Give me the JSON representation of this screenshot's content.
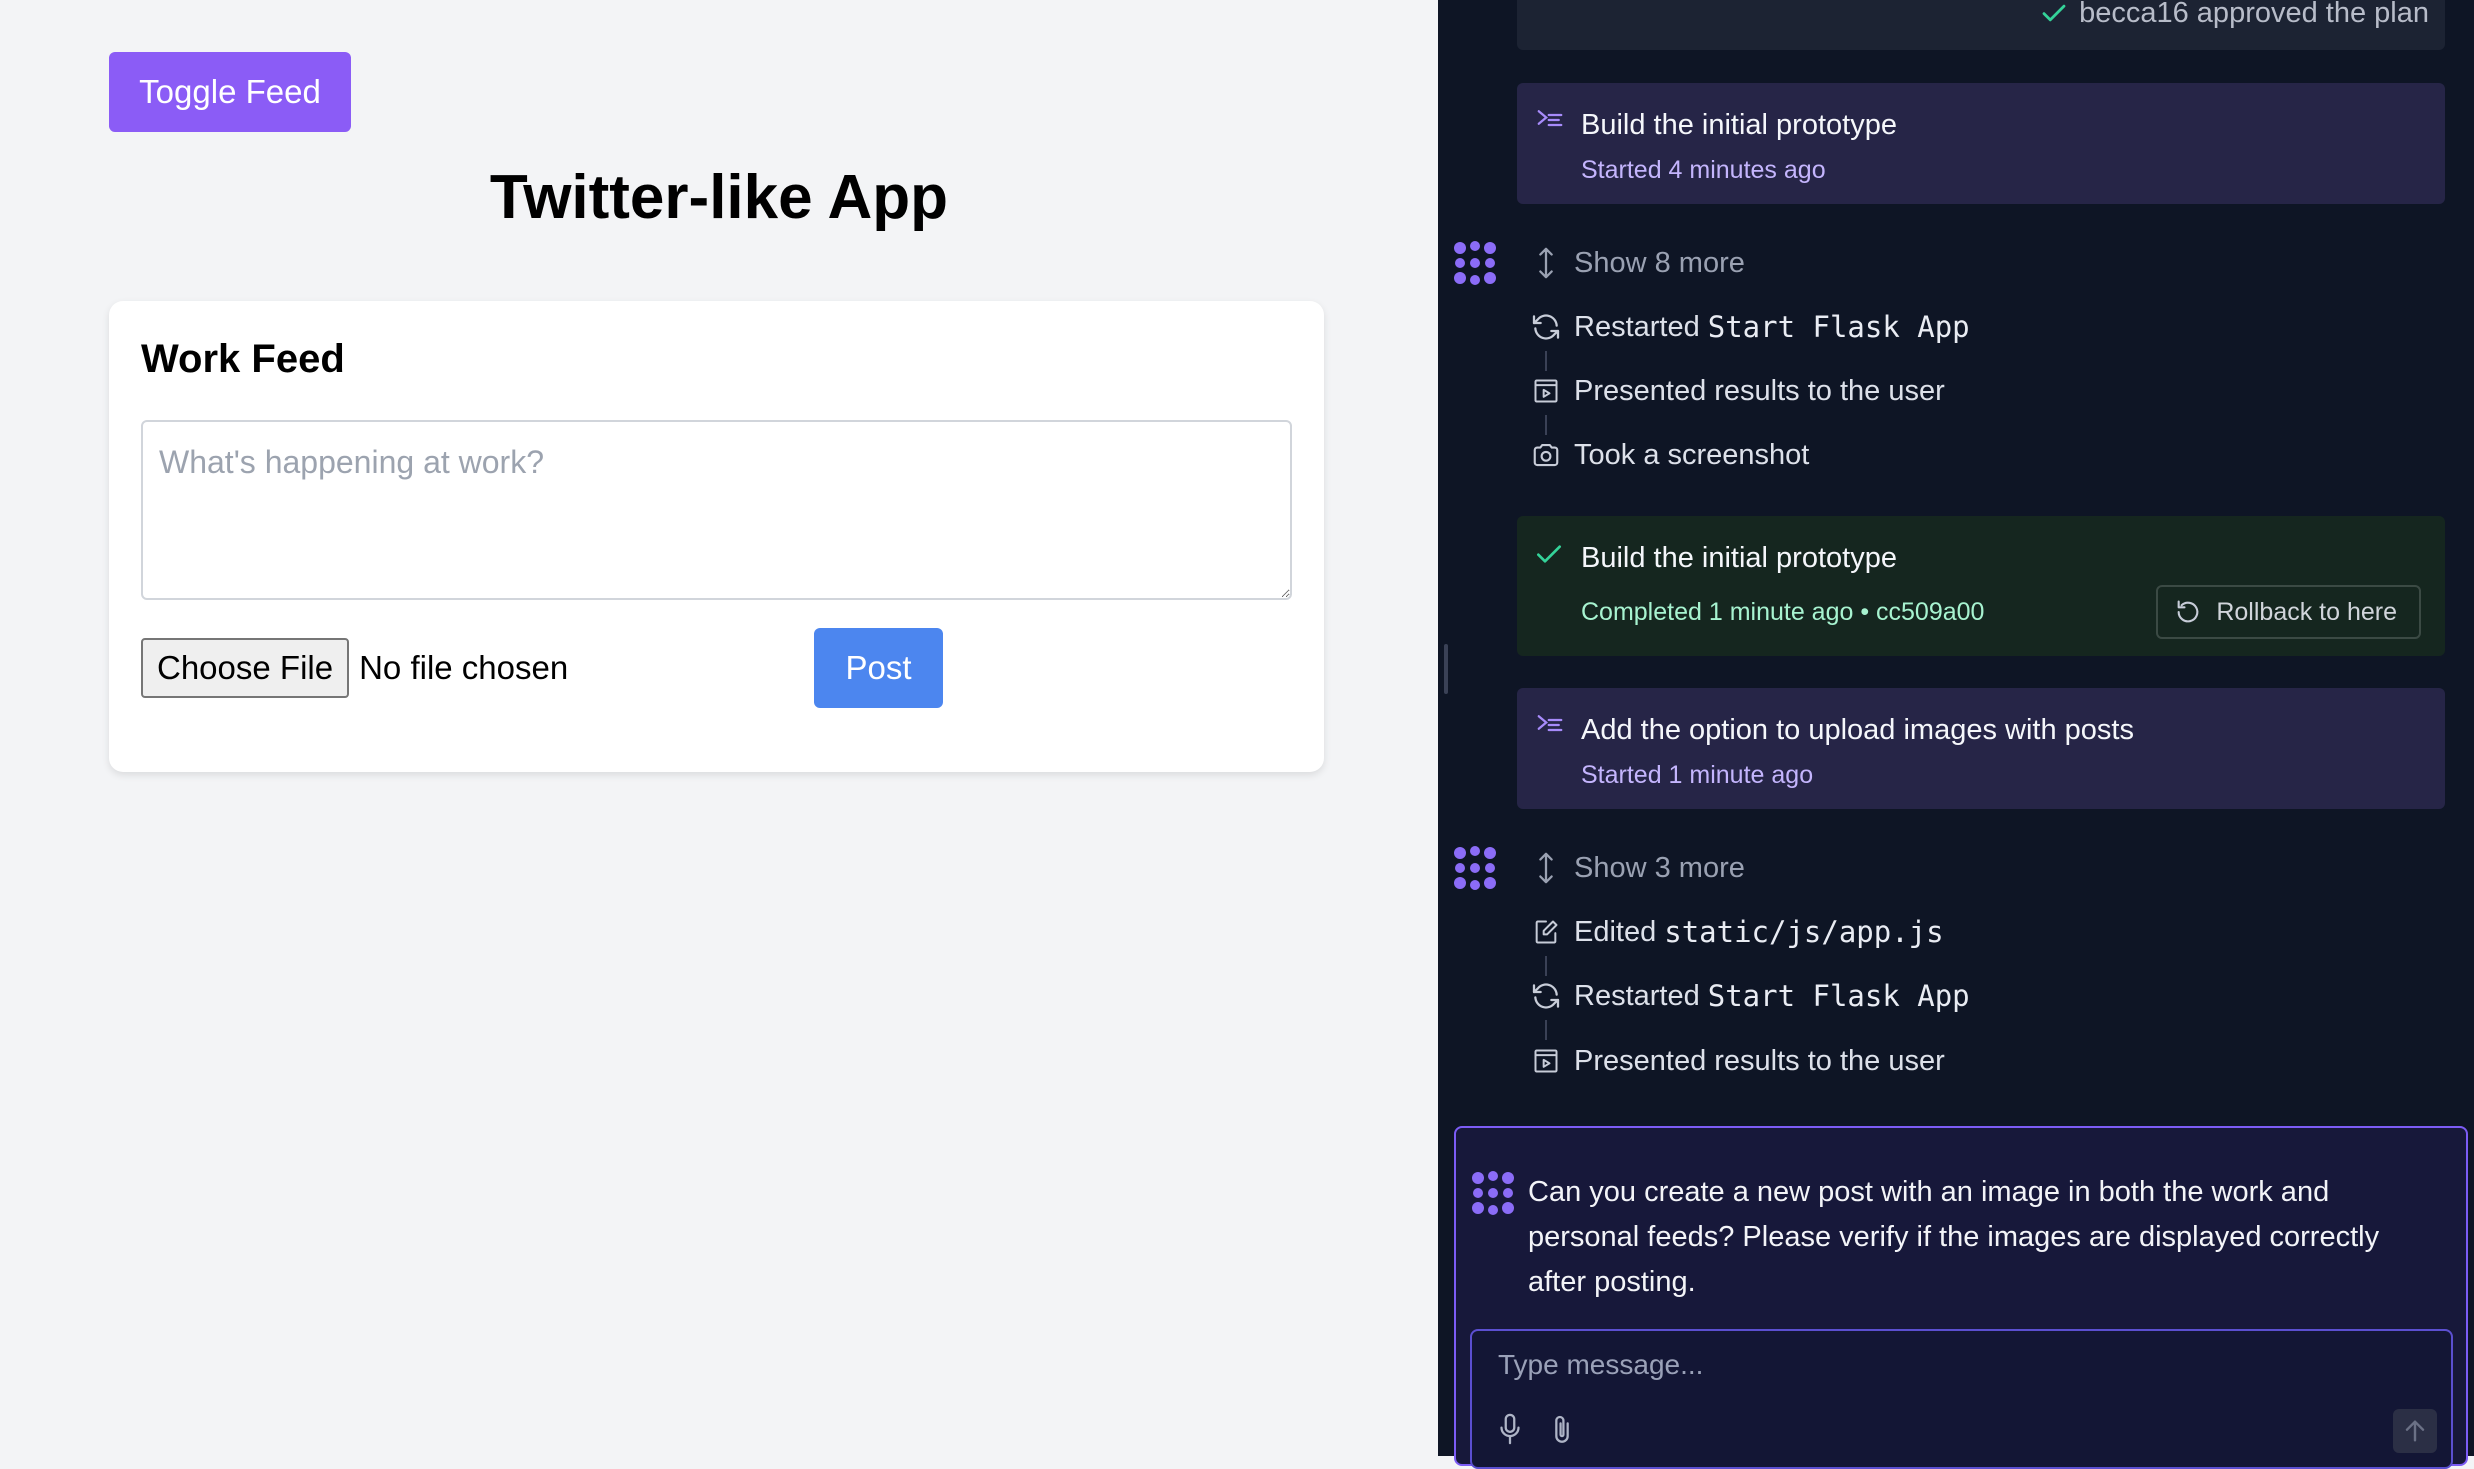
{
  "preview": {
    "toggle_label": "Toggle Feed",
    "app_title": "Twitter-like App",
    "feed": {
      "title": "Work Feed",
      "textarea_placeholder": "What's happening at work?",
      "choose_file_label": "Choose File",
      "file_status": "No file chosen",
      "post_label": "Post"
    }
  },
  "agent_panel": {
    "approval_text": "becca16 approved the plan",
    "tasks": [
      {
        "title": "Build the initial prototype",
        "status": "Started 4 minutes ago",
        "state": "started"
      },
      {
        "title": "Build the initial prototype",
        "status": "Completed 1 minute ago • cc509a00",
        "state": "completed",
        "rollback_label": "Rollback to here"
      },
      {
        "title": "Add the option to upload images with posts",
        "status": "Started 1 minute ago",
        "state": "started"
      }
    ],
    "group1": {
      "show_more": "Show 8 more",
      "actions": [
        {
          "icon": "restart-icon",
          "label": "Restarted",
          "code": "Start Flask App"
        },
        {
          "icon": "presentation-icon",
          "label": "Presented results to the user",
          "code": ""
        },
        {
          "icon": "camera-icon",
          "label": "Took a screenshot",
          "code": ""
        }
      ]
    },
    "group2": {
      "show_more": "Show 3 more",
      "actions": [
        {
          "icon": "edit-file-icon",
          "label": "Edited",
          "code": "static/js/app.js"
        },
        {
          "icon": "restart-icon",
          "label": "Restarted",
          "code": "Start Flask App"
        },
        {
          "icon": "presentation-icon",
          "label": "Presented results to the user",
          "code": ""
        }
      ]
    },
    "prompt_message": "Can you create a new post with an image in both the work and personal feeds? Please verify if the images are displayed correctly after posting.",
    "composer_placeholder": "Type message...",
    "colors": {
      "accent_purple": "#8b5cf6",
      "post_blue": "#4c86ef",
      "panel_bg": "#0e1525",
      "task_started_bg": "#262547",
      "task_completed_bg": "#15261f"
    }
  }
}
